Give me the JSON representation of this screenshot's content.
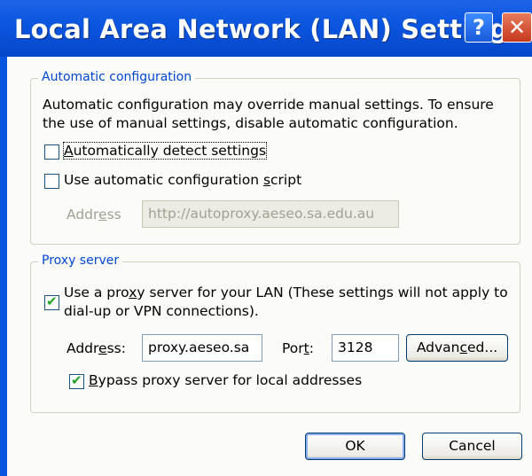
{
  "window": {
    "title": "Local Area Network (LAN) Settings",
    "help_label": "?",
    "close_label": "✕"
  },
  "auto_config": {
    "legend": "Automatic configuration",
    "description": "Automatic configuration may override manual settings.  To ensure the use of manual settings, disable automatic configuration.",
    "detect": {
      "label_pre": "",
      "label_u": "A",
      "label_post": "utomatically detect settings",
      "checked": false
    },
    "script": {
      "label_pre": "Use automatic configuration ",
      "label_u": "s",
      "label_post": "cript",
      "checked": false
    },
    "address": {
      "label_pre": "Addr",
      "label_u": "e",
      "label_post": "ss",
      "value": "http://autoproxy.aeseo.sa.edu.au",
      "disabled": true
    }
  },
  "proxy": {
    "legend": "Proxy server",
    "use_proxy": {
      "label_line1_pre": "Use a pro",
      "label_line1_u": "x",
      "label_line1_post": "y server for your LAN (These settings will not apply to",
      "label_line2": "dial-up or VPN connections).",
      "checked": true
    },
    "address": {
      "label_pre": "Addr",
      "label_u": "e",
      "label_post": "ss:",
      "value": "proxy.aeseo.sa"
    },
    "port": {
      "label_pre": "Por",
      "label_u": "t",
      "label_post": ":",
      "value": "3128"
    },
    "advanced": {
      "label_pre": "Advan",
      "label_u": "c",
      "label_post": "ed..."
    },
    "bypass": {
      "label_pre": "",
      "label_u": "B",
      "label_post": "ypass proxy server for local addresses",
      "checked": true
    }
  },
  "buttons": {
    "ok": "OK",
    "cancel": "Cancel"
  },
  "colors": {
    "titlebar": "#0a55df",
    "legend": "#0046d5",
    "check": "#21a121"
  }
}
